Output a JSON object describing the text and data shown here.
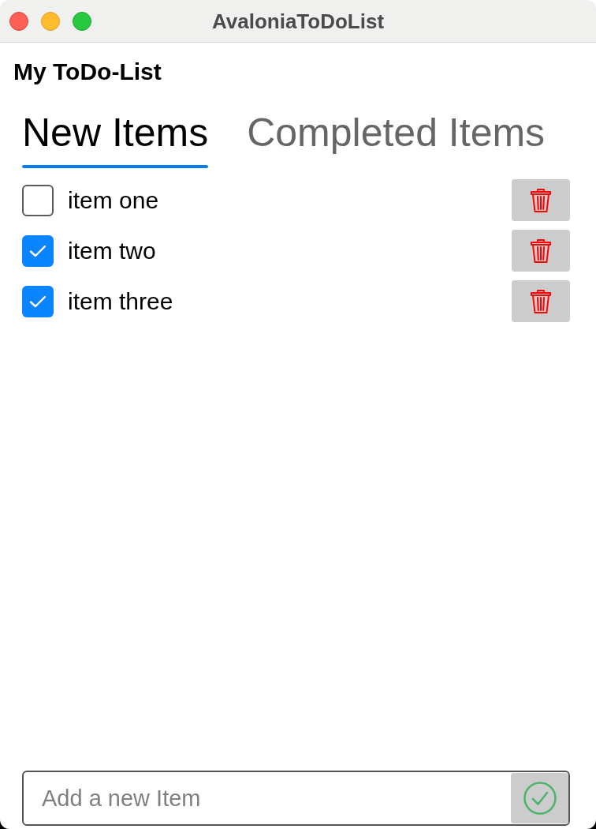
{
  "window": {
    "title": "AvaloniaToDoList"
  },
  "heading": "My ToDo-List",
  "tabs": [
    {
      "label": "New Items",
      "selected": true
    },
    {
      "label": "Completed Items",
      "selected": false
    }
  ],
  "items": [
    {
      "label": "item one",
      "checked": false
    },
    {
      "label": "item two",
      "checked": true
    },
    {
      "label": "item three",
      "checked": true
    }
  ],
  "new_item": {
    "placeholder": "Add a new Item"
  }
}
